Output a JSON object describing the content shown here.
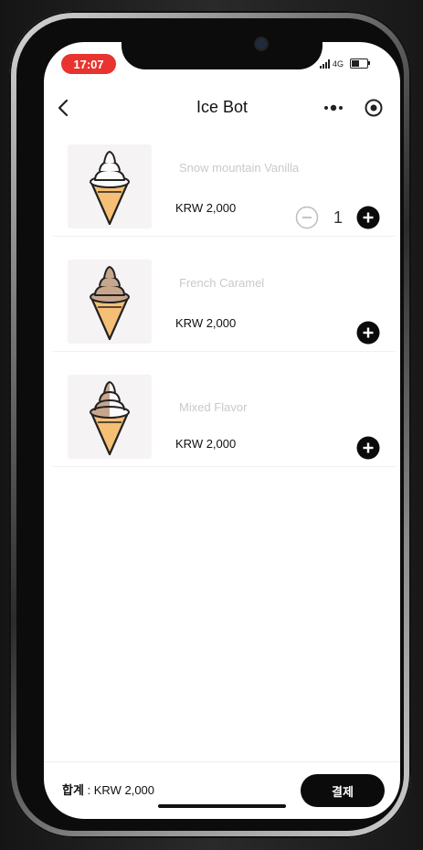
{
  "status": {
    "time": "17:07",
    "network": "4G"
  },
  "header": {
    "title": "Ice Bot"
  },
  "products": [
    {
      "name": "Snow mountain Vanilla",
      "price": "KRW 2,000",
      "quantity": "1",
      "flavor": "vanilla"
    },
    {
      "name": "French Caramel",
      "price": "KRW 2,000",
      "flavor": "caramel"
    },
    {
      "name": "Mixed Flavor",
      "price": "KRW 2,000",
      "flavor": "mixed"
    }
  ],
  "footer": {
    "total_label": "합계",
    "total_separator": " : ",
    "total_value": "KRW 2,000",
    "pay_label": "결제"
  },
  "colors": {
    "accent": "#0b0b0b",
    "time_pill": "#e8332f",
    "name_text": "#c9c9c9"
  }
}
